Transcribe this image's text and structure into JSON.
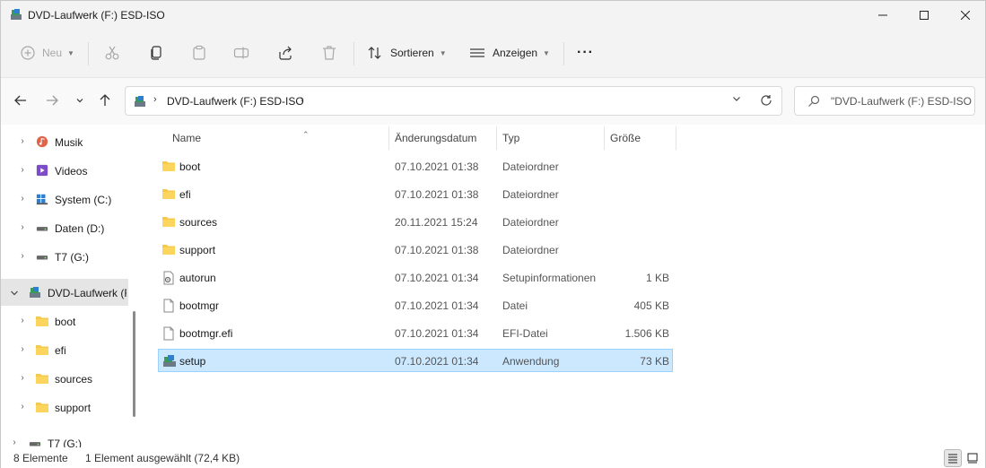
{
  "window": {
    "title": "DVD-Laufwerk (F:) ESD-ISO"
  },
  "toolbar": {
    "new_label": "Neu",
    "sort_label": "Sortieren",
    "view_label": "Anzeigen",
    "more_label": "···"
  },
  "address": {
    "path": "DVD-Laufwerk (F:) ESD-ISO",
    "search_placeholder": "\"DVD-Laufwerk (F:) ESD-ISO..."
  },
  "sidebar": {
    "items": [
      {
        "label": "Musik",
        "icon": "music-icon"
      },
      {
        "label": "Videos",
        "icon": "videos-icon"
      },
      {
        "label": "System (C:)",
        "icon": "windows-drive-icon"
      },
      {
        "label": "Daten (D:)",
        "icon": "drive-icon"
      },
      {
        "label": "T7 (G:)",
        "icon": "drive-icon"
      },
      {
        "label": "DVD-Laufwerk (F:) ESD-ISO",
        "icon": "dvd-drive-icon"
      },
      {
        "label": "boot",
        "icon": "folder-icon"
      },
      {
        "label": "efi",
        "icon": "folder-icon"
      },
      {
        "label": "sources",
        "icon": "folder-icon"
      },
      {
        "label": "support",
        "icon": "folder-icon"
      },
      {
        "label": "T7 (G:)",
        "icon": "drive-icon"
      }
    ]
  },
  "columns": {
    "name": "Name",
    "date": "Änderungsdatum",
    "type": "Typ",
    "size": "Größe"
  },
  "files": [
    {
      "name": "boot",
      "date": "07.10.2021 01:38",
      "type": "Dateiordner",
      "size": "",
      "icon": "folder-icon"
    },
    {
      "name": "efi",
      "date": "07.10.2021 01:38",
      "type": "Dateiordner",
      "size": "",
      "icon": "folder-icon"
    },
    {
      "name": "sources",
      "date": "20.11.2021 15:24",
      "type": "Dateiordner",
      "size": "",
      "icon": "folder-icon"
    },
    {
      "name": "support",
      "date": "07.10.2021 01:38",
      "type": "Dateiordner",
      "size": "",
      "icon": "folder-icon"
    },
    {
      "name": "autorun",
      "date": "07.10.2021 01:34",
      "type": "Setupinformationen",
      "size": "1 KB",
      "icon": "settings-file-icon"
    },
    {
      "name": "bootmgr",
      "date": "07.10.2021 01:34",
      "type": "Datei",
      "size": "405 KB",
      "icon": "file-icon"
    },
    {
      "name": "bootmgr.efi",
      "date": "07.10.2021 01:34",
      "type": "EFI-Datei",
      "size": "1.506 KB",
      "icon": "file-icon"
    },
    {
      "name": "setup",
      "date": "07.10.2021 01:34",
      "type": "Anwendung",
      "size": "73 KB",
      "icon": "setup-app-icon"
    }
  ],
  "status": {
    "count": "8 Elemente",
    "selection": "1 Element ausgewählt (72,4 KB)"
  },
  "colors": {
    "selection_bg": "#cce8ff",
    "selection_border": "#99d1ff",
    "folder": "#f7c948",
    "chrome_bg": "#f3f3f3"
  }
}
